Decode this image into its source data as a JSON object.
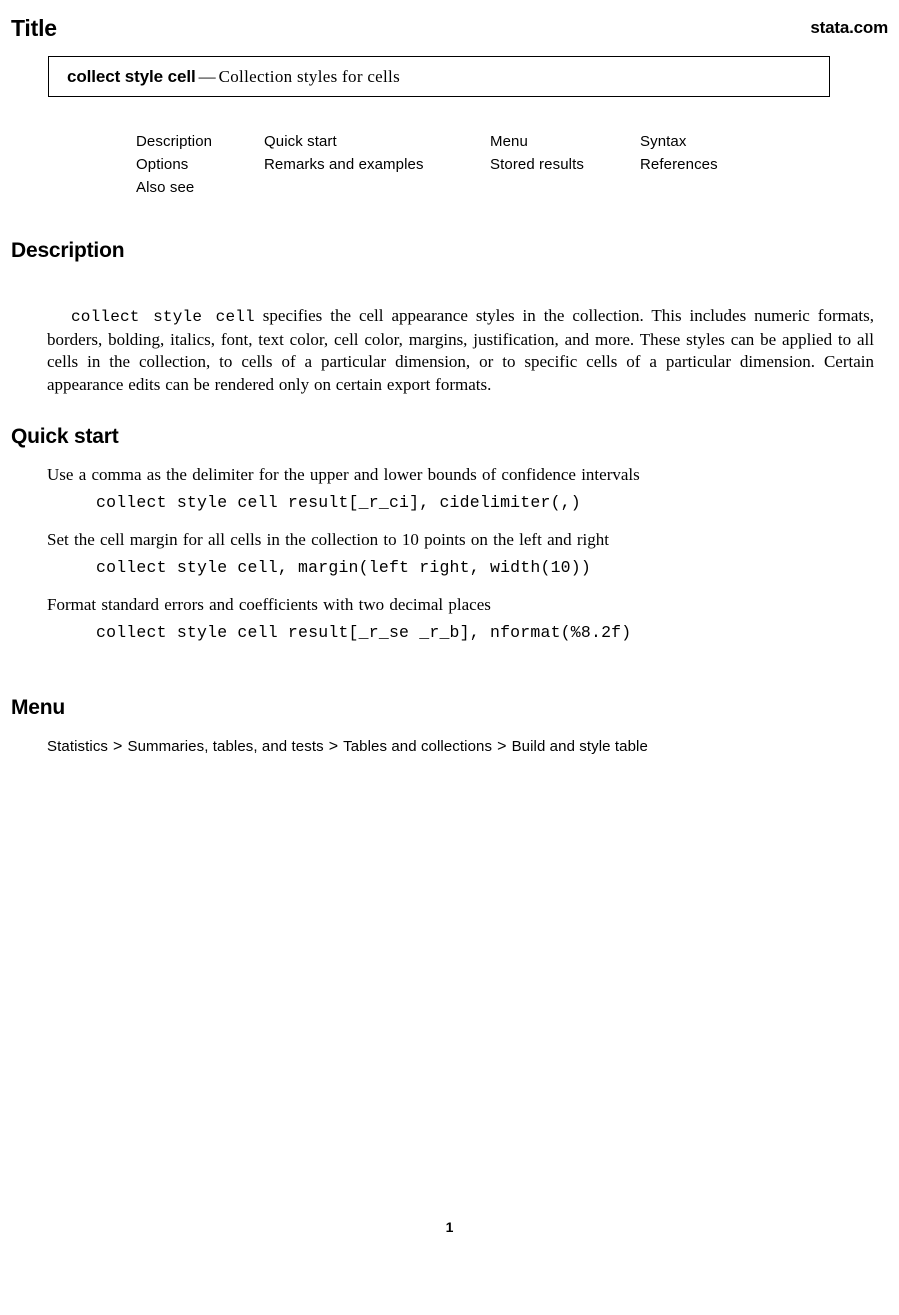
{
  "header": {
    "title_word": "Title",
    "site": "stata.com"
  },
  "title_box": {
    "command": "collect style cell",
    "dash": "—",
    "description": "Collection styles for cells"
  },
  "nav": {
    "columns": [
      {
        "items": [
          "Description",
          "Options",
          "Also see"
        ]
      },
      {
        "items": [
          "Quick start",
          "Remarks and examples"
        ]
      },
      {
        "items": [
          "Menu",
          "Stored results"
        ]
      },
      {
        "items": [
          "Syntax",
          "References"
        ]
      }
    ]
  },
  "sections": {
    "description": {
      "heading": "Description",
      "lead_code": "collect style cell",
      "body": " specifies the cell appearance styles in the collection. This includes numeric formats, borders, bolding, italics, font, text color, cell color, margins, justification, and more. These styles can be applied to all cells in the collection, to cells of a particular dimension, or to specific cells of a particular dimension. Certain appearance edits can be rendered only on certain export formats."
    },
    "quick_start": {
      "heading": "Quick start",
      "items": [
        {
          "text": "Use a comma as the delimiter for the upper and lower bounds of confidence intervals",
          "code": "collect style cell result[_r_ci], cidelimiter(,)"
        },
        {
          "text": "Set the cell margin for all cells in the collection to 10 points on the left and right",
          "code": "collect style cell, margin(left right, width(10))"
        },
        {
          "text": "Format standard errors and coefficients with two decimal places",
          "code": "collect style cell result[_r_se _r_b], nformat(%8.2f)"
        }
      ]
    },
    "menu": {
      "heading": "Menu",
      "path": [
        "Statistics",
        "Summaries, tables, and tests",
        "Tables and collections",
        "Build and style table"
      ],
      "separator": ">"
    }
  },
  "footer": {
    "page_number": "1"
  }
}
